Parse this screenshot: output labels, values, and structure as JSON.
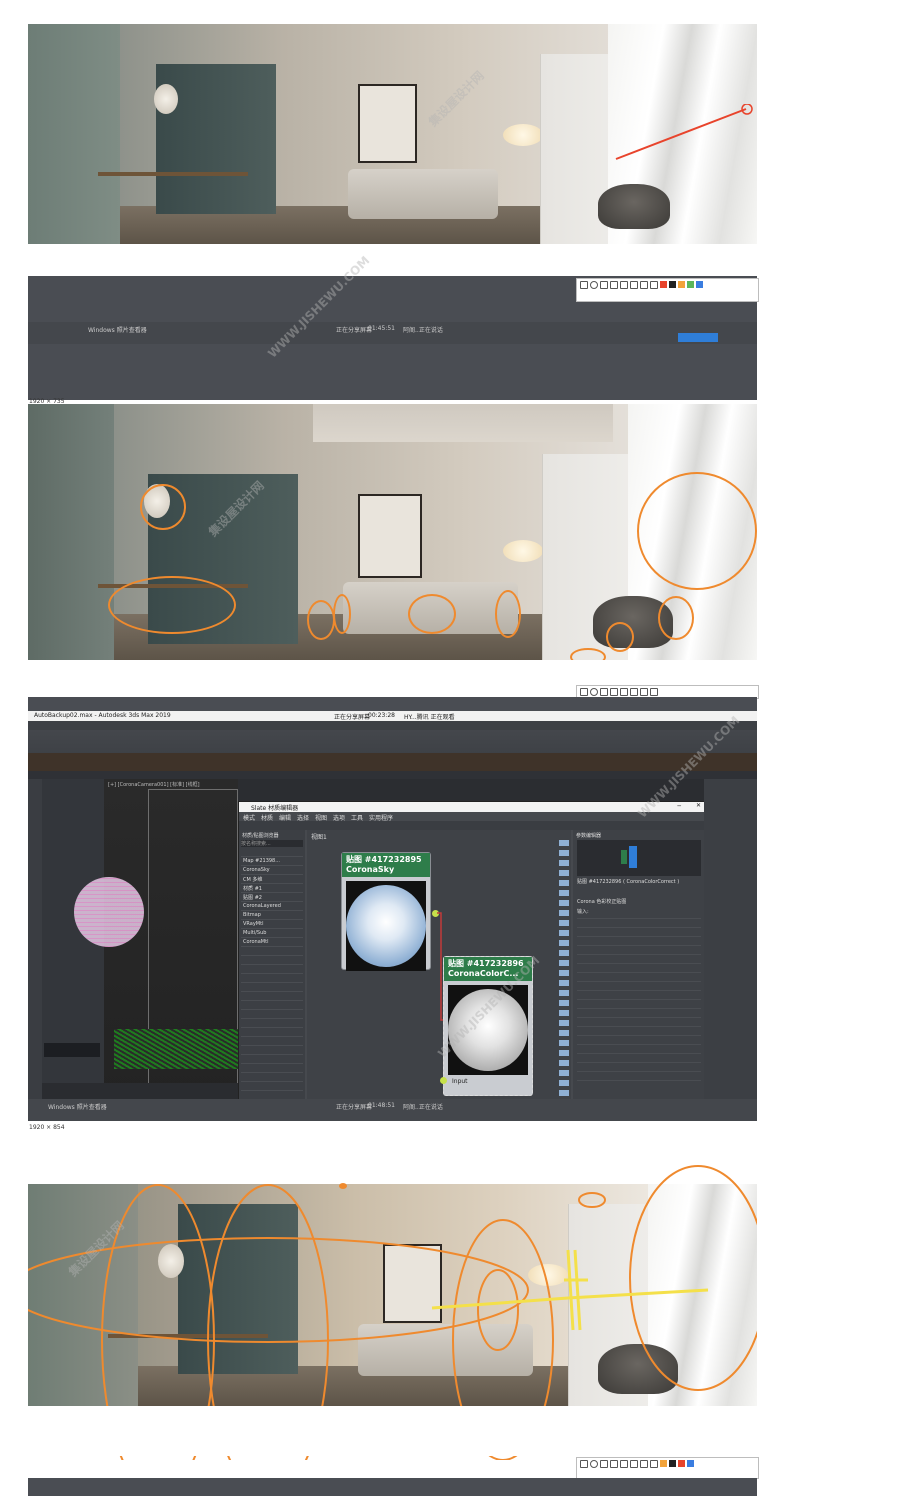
{
  "screen1": {
    "caption": ""
  },
  "titlebar1": {
    "title": "Windows 照片查看器",
    "file": "",
    "status": "正在分享屏幕",
    "timer": "01:45:51",
    "speaker": "阿阁..正在说话"
  },
  "screen2": {
    "size_label": "1920 × 735"
  },
  "max": {
    "title": "AutoBackup02.max - Autodesk 3ds Max 2019",
    "status": "正在分享屏幕",
    "timer": "00:23:28",
    "speaker": "HY...腾讯 正在观看",
    "viewport_label": "[+] [CoronaCamera001] [标准] [线框]",
    "slate": {
      "title": "Slate 材质编辑器",
      "menu": [
        "模式",
        "材质",
        "编辑",
        "选择",
        "视图",
        "选项",
        "工具",
        "实用程序"
      ],
      "browser_header": "材质/贴图浏览器",
      "search_placeholder": "按名称搜索...",
      "view_tab": "视图1",
      "params_header": "参数编辑器",
      "node1": {
        "title": "贴图 #417232895",
        "subtitle": "CoronaSky"
      },
      "node2": {
        "title": "贴图 #417232896",
        "subtitle": "CoronaColorC...",
        "socket": "Input"
      },
      "map_title": "贴图 #417232896 ( CoronaColorCorrect )",
      "rollout": "Corona 色彩校正贴图",
      "input_label": "输入:"
    },
    "left_items": [
      "Map #21398...",
      "CoronaSky",
      "CM 多维",
      "材质 #1",
      "贴图 #2",
      "CoronaLayered",
      "Bitmap",
      "VRayMtl",
      "Multi/Sub",
      "CoronaMtl"
    ]
  },
  "titlebar2": {
    "title": "Windows 照片查看器",
    "status": "正在分享屏幕",
    "timer": "01:48:51",
    "speaker": "阿阁..正在说话"
  },
  "screen4": {
    "size_label": "1920 × 854"
  },
  "watermark": {
    "cn": "集设屋设计网",
    "en": "WWW.JISHEWU.COM"
  }
}
